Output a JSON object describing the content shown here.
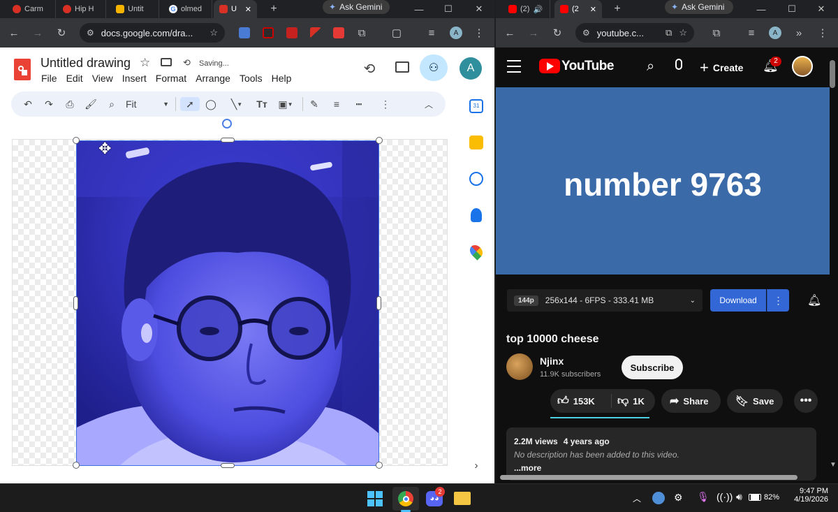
{
  "left_browser": {
    "tabs": [
      {
        "label": "Carm",
        "color": "#d93025"
      },
      {
        "label": "Hip H",
        "color": "#d93025"
      },
      {
        "label": "Untit",
        "color": "#f4b400"
      },
      {
        "label": "olmed",
        "color": "#ffffff"
      },
      {
        "label": "U",
        "color": "#d93025"
      }
    ],
    "new_tab": "+",
    "ask_gemini": "Ask Gemini",
    "url": "docs.google.com/dra..."
  },
  "docs": {
    "title": "Untitled drawing",
    "saving_status": "Saving...",
    "menu": [
      "File",
      "Edit",
      "View",
      "Insert",
      "Format",
      "Arrange",
      "Tools",
      "Help"
    ],
    "zoom": "Fit",
    "account_initial": "A",
    "calendar_day": "31"
  },
  "right_browser": {
    "tabs": [
      {
        "label": "(2)",
        "color": "#ff0000"
      },
      {
        "label": "(2",
        "color": "#ff0000"
      }
    ],
    "new_tab": "+",
    "ask_gemini": "Ask Gemini",
    "url": "youtube.c..."
  },
  "youtube": {
    "logo_text": "YouTube",
    "create_label": "Create",
    "notification_count": "2",
    "video_text": "number 9763",
    "quality_badge": "144p",
    "quality_detail": "256x144 - 6FPS - 333.41 MB",
    "download_label": "Download",
    "video_title": "top 10000 cheese",
    "channel_name": "Njinx",
    "subscribers": "11.9K subscribers",
    "subscribe_label": "Subscribe",
    "likes": "153K",
    "dislikes": "1K",
    "share_label": "Share",
    "save_label": "Save",
    "views": "2.2M views",
    "age": "4 years ago",
    "description": "No description has been added to this video.",
    "more_label": "...more"
  },
  "taskbar": {
    "discord_badge": "2",
    "battery": "82%",
    "time": "9:47 PM",
    "date": "4/19/2026"
  },
  "colors": {
    "yt_red": "#ff0000",
    "yt_video_bg": "#3a6aa8",
    "download_blue": "#3367d6",
    "photo_tint": "#3a3ad8"
  }
}
